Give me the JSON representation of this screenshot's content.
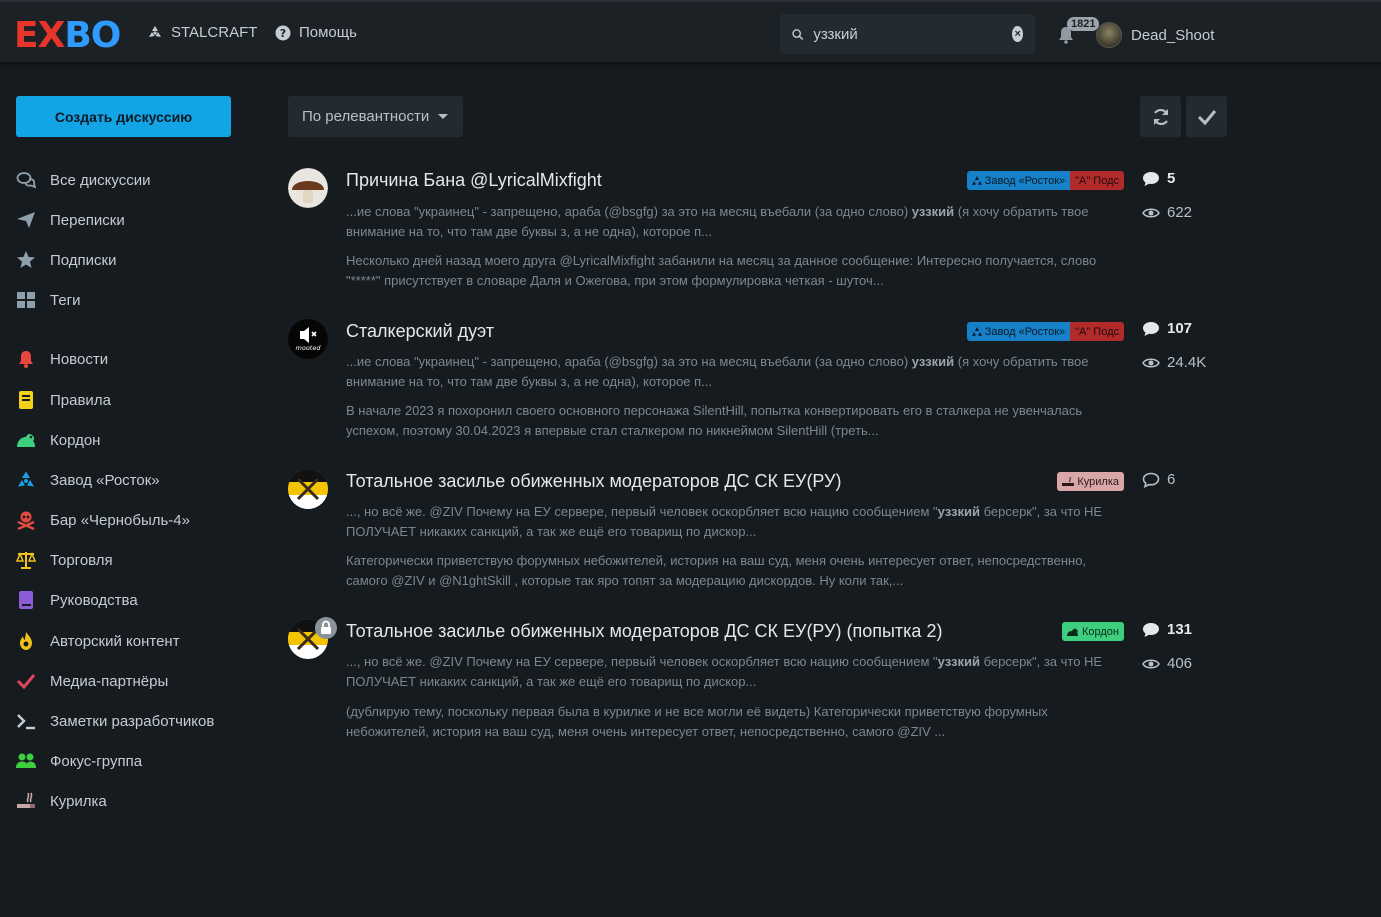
{
  "header": {
    "logo_left": "EX",
    "logo_right": "BO",
    "nav": [
      {
        "label": "STALCRAFT",
        "icon": "radiation-icon"
      },
      {
        "label": "Помощь",
        "icon": "help-icon"
      }
    ],
    "search_value": "уззкий",
    "notifications_count": "1821",
    "username": "Dead_Shoot"
  },
  "sidebar": {
    "create_label": "Создать дискуссию",
    "items": [
      {
        "label": "Все дискуссии",
        "icon": "comments-icon",
        "color": "#8fa0ad"
      },
      {
        "label": "Переписки",
        "icon": "paper-plane-icon",
        "color": "#8fa0ad"
      },
      {
        "label": "Подписки",
        "icon": "star-icon",
        "color": "#8fa0ad"
      },
      {
        "label": "Теги",
        "icon": "grid-icon",
        "color": "#8fa0ad"
      },
      {
        "label": "Новости",
        "icon": "bell-icon",
        "color": "#e8473d"
      },
      {
        "label": "Правила",
        "icon": "book-icon",
        "color": "#f2d21b"
      },
      {
        "label": "Кордон",
        "icon": "frog-icon",
        "color": "#3dcf7e"
      },
      {
        "label": "Завод «Росток»",
        "icon": "radiation-icon",
        "color": "#1c9ee6"
      },
      {
        "label": "Бар «Чернобыль-4»",
        "icon": "skull-icon",
        "color": "#e34a3f"
      },
      {
        "label": "Торговля",
        "icon": "scales-icon",
        "color": "#f2c21b"
      },
      {
        "label": "Руководства",
        "icon": "book-icon",
        "color": "#8e5bd6"
      },
      {
        "label": "Авторский контент",
        "icon": "fire-icon",
        "color": "#f2c21b"
      },
      {
        "label": "Медиа-партнёры",
        "icon": "check-icon",
        "color": "#e0455f"
      },
      {
        "label": "Заметки разработчиков",
        "icon": "terminal-icon",
        "color": "#c5ccd2"
      },
      {
        "label": "Фокус-группа",
        "icon": "users-icon",
        "color": "#3dcf3d"
      },
      {
        "label": "Курилка",
        "icon": "smoking-icon",
        "color": "#c5a7a7"
      }
    ]
  },
  "toolbar": {
    "sort_label": "По релевантности"
  },
  "discussions": [
    {
      "title": "Причина Бана @LyricalMixfight",
      "tags": [
        {
          "label": "Завод «Росток»",
          "color": "#1681c8"
        },
        {
          "label": "Подс",
          "color": "#b32a2a"
        }
      ],
      "excerpt1_pre": "...ие слова \"украинец\" - запрещено, араба (@bsgfg) за это на месяц въебали (за одно слово)",
      "excerpt1_bold": "уззкий",
      "excerpt1_post": "(я хочу обратить твое внимание на то, что там две буквы з, а не одна), которое п...",
      "excerpt2": "Несколько дней назад моего друга @LyricalMixfight забанили на месяц за данное сообщение: Интересно получается, слово \"*****\" присутствует в словаре Даля и Ожегова, при этом формулировка четкая - шуточ...",
      "replies": "5",
      "views": "622"
    },
    {
      "title": "Сталкерский дуэт",
      "tags": [
        {
          "label": "Завод «Росток»",
          "color": "#1681c8"
        },
        {
          "label": "Подс",
          "color": "#b32a2a"
        }
      ],
      "excerpt1_pre": "...ие слова \"украинец\" - запрещено, араба (@bsgfg) за это на месяц въебали (за одно слово)",
      "excerpt1_bold": "уззкий",
      "excerpt1_post": "(я хочу обратить твое внимание на то, что там две буквы з, а не одна), которое п...",
      "excerpt2": "В начале 2023 я похоронил своего основного персонажа SilentHill, попытка конвертировать его в сталкера не увенчалась успехом, поэтому 30.04.2023 я впервые стал сталкером по никнеймом SilentHill (треть...",
      "replies": "107",
      "views": "24.4K"
    },
    {
      "title": "Тотальное засилье обиженных модераторов ДС СК ЕУ(РУ)",
      "tags": [
        {
          "label": "Курилка",
          "color": "#d9a7a7"
        }
      ],
      "excerpt1_pre": "..., но всё же. @ZIV Почему на ЕУ сервере, первый человек оскорбляет всю нацию сообщением \"",
      "excerpt1_bold": "уззкий",
      "excerpt1_post": "берсерк\", за что НЕ ПОЛУЧАЕТ никаких санкций, а так же ещё его товарищ по дискор...",
      "excerpt2": "Категорически приветствую форумных небожителей, история на ваш суд, меня очень интересует ответ, непосредственно, самого @ZIV и @N1ghtSkill , которые так яро топят за модерацию дискордов. Ну коли так,...",
      "replies": "6",
      "views": ""
    },
    {
      "title": "Тотальное засилье обиженных модераторов ДС СК ЕУ(РУ) (попытка 2)",
      "tags": [
        {
          "label": "Кордон",
          "color": "#3dcf7e"
        }
      ],
      "excerpt1_pre": "..., но всё же. @ZIV Почему на ЕУ сервере, первый человек оскорбляет всю нацию сообщением \"",
      "excerpt1_bold": "уззкий",
      "excerpt1_post": "берсерк\", за что НЕ ПОЛУЧАЕТ никаких санкций, а так же ещё его товарищ по дискор...",
      "excerpt2": "(дублирую тему, поскольку первая была в курилке и не все могли её видеть) Категорически приветствую форумных небожителей, история на ваш суд, меня очень интересует ответ, непосредственно, самого @ZIV ...",
      "replies": "131",
      "views": "406"
    }
  ],
  "muted_label": "mooted"
}
